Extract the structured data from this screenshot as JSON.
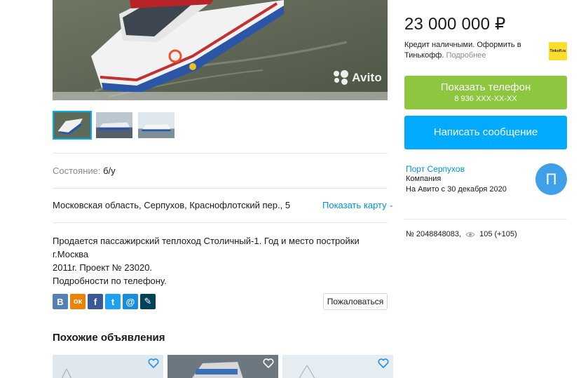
{
  "gallery": {
    "watermark": "Avito",
    "thumbnails_count": 3,
    "active_thumbnail": 0
  },
  "params": {
    "condition_key": "Состояние:",
    "condition_value": "б/у"
  },
  "location": {
    "address": "Московская область, Серпухов, Краснофлотский пер., 5",
    "map_link": "Показать карту"
  },
  "description": {
    "line1": "Продается пассажирский теплоход Столичный-1. Год и место постройки г.Москва",
    "line2": "2011г. Проект № 23020.",
    "line3": "Подробности по телефону."
  },
  "share": {
    "buttons": [
      {
        "icon": "vk-icon",
        "glyph": "В",
        "color": "#5181b8"
      },
      {
        "icon": "odnoklassniki-icon",
        "glyph": "ок",
        "color": "#ee8208"
      },
      {
        "icon": "facebook-icon",
        "glyph": "f",
        "color": "#3b5998"
      },
      {
        "icon": "twitter-icon",
        "glyph": "t",
        "color": "#1da1f2"
      },
      {
        "icon": "mail-icon",
        "glyph": "@",
        "color": "#168de2"
      },
      {
        "icon": "livejournal-icon",
        "glyph": "✎",
        "color": "#004359"
      }
    ],
    "complain_label": "Пожаловаться"
  },
  "similar": {
    "title": "Похожие объявления",
    "cards_count": 3
  },
  "sidebar": {
    "price": "23 000 000 ₽",
    "credit_text": "Кредит наличными. Оформить в Тинькофф.",
    "credit_more": "Подробнее",
    "tinkoff_logo_text": "Tinkoff.ru",
    "phone_button_label": "Показать телефон",
    "phone_masked": "8 936 XXX-XX-XX",
    "message_button_label": "Написать сообщение",
    "seller_name": "Порт Серпухов",
    "seller_type": "Компания",
    "seller_since": "На Авито с 30 декабря 2020",
    "avatar_letter": "П",
    "ad_number": "№ 2048848083,",
    "views": "105 (+105)"
  },
  "colors": {
    "accent_blue": "#00aaff",
    "phone_green": "#8dc63f",
    "link_blue": "#0091e4",
    "avatar_blue": "#3da0e8"
  }
}
